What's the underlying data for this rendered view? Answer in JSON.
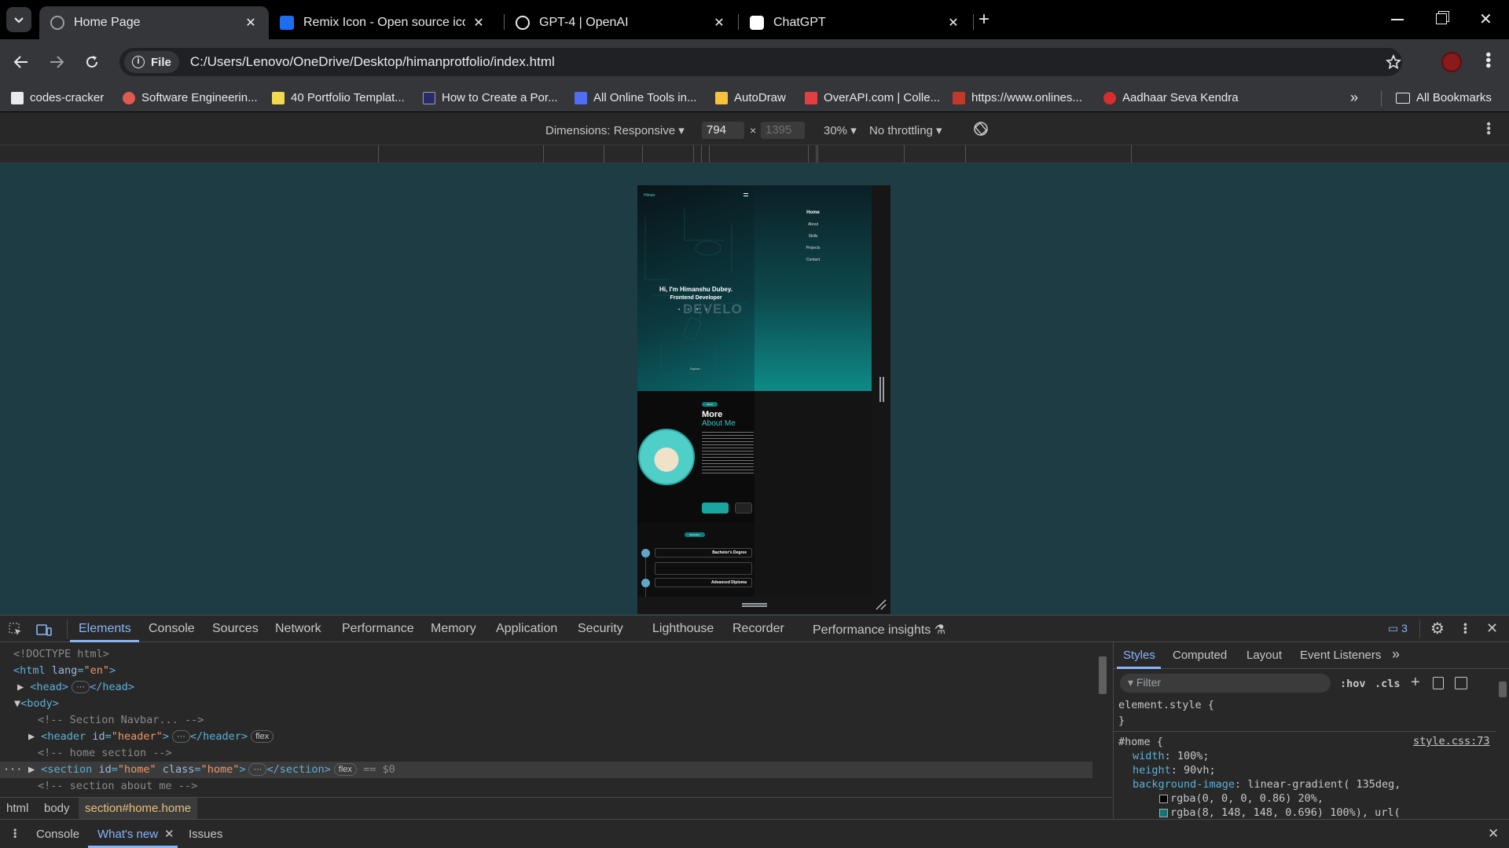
{
  "browser": {
    "tabs": [
      {
        "title": "Home Page",
        "active": true,
        "icon": "globe-icon"
      },
      {
        "title": "Remix Icon - Open source icon",
        "active": false,
        "icon": "remix-icon"
      },
      {
        "title": "GPT-4 | OpenAI",
        "active": false,
        "icon": "openai-icon"
      },
      {
        "title": "ChatGPT",
        "active": false,
        "icon": "chatgpt-icon"
      }
    ],
    "chip_label": "File",
    "url": "C:/Users/Lenovo/OneDrive/Desktop/himanprotfolio/index.html",
    "bookmarks": [
      {
        "label": "codes-cracker",
        "color": "#e8eaed"
      },
      {
        "label": "Software Engineerin...",
        "color": "#e05a4f"
      },
      {
        "label": "40 Portfolio Templat...",
        "color": "#f0db4f"
      },
      {
        "label": "How to Create a Por...",
        "color": "#2b2b6a"
      },
      {
        "label": "All Online Tools in...",
        "color": "#4f6df5"
      },
      {
        "label": "AutoDraw",
        "color": "#f7c23c"
      },
      {
        "label": "OverAPI.com | Colle...",
        "color": "#e04040"
      },
      {
        "label": "https://www.onlines...",
        "color": "#c0392b"
      },
      {
        "label": "Aadhaar Seva Kendra",
        "color": "#d62d2d"
      }
    ],
    "all_bookmarks_label": "All Bookmarks"
  },
  "device_toolbar": {
    "dimensions_label": "Dimensions: Responsive",
    "width": "794",
    "height": "1395",
    "zoom": "30%",
    "throttling": "No throttling"
  },
  "preview": {
    "logo": "Himan",
    "menu_items": [
      "Home",
      "About",
      "Skills",
      "Projects",
      "Contact"
    ],
    "hero_line1": "Hi, I'm Himanshu Dubey.",
    "hero_line2": "Frontend Developer",
    "hero_bg_word": "DEVELO",
    "explore": "Explore ↓",
    "about_badge": "About",
    "about_title1": "More",
    "about_title2": "About Me",
    "edu_badge": "Education",
    "edu_items": [
      "Bachelor's Degree",
      "Advanced Diploma"
    ]
  },
  "devtools": {
    "tabs": [
      "Elements",
      "Console",
      "Sources",
      "Network",
      "Performance",
      "Memory",
      "Application",
      "Security",
      "Lighthouse",
      "Recorder",
      "Performance insights"
    ],
    "issues_count": "3",
    "dom": {
      "doctype": "<!DOCTYPE html>",
      "html_open": "html",
      "html_attr": "lang",
      "html_val": "\"en\"",
      "head": "head",
      "body": "body",
      "comment_nav": "<!-- Section Navbar... -->",
      "header_tag": "header",
      "header_attr": "id",
      "header_val": "\"header\"",
      "comment_home": "<!-- home section  -->",
      "section_tag": "section",
      "section_id_attr": "id",
      "section_id_val": "\"home\"",
      "section_class_attr": "class",
      "section_class_val": "\"home\"",
      "flex_pill": "flex",
      "selected_marker": "== $0",
      "comment_about": "<!-- section about me -->"
    },
    "breadcrumbs": [
      "html",
      "body",
      "section#home.home"
    ],
    "styles_tabs": [
      "Styles",
      "Computed",
      "Layout",
      "Event Listeners"
    ],
    "filter_placeholder": "Filter",
    "hov": ":hov",
    "cls": ".cls",
    "element_style": "element.style {",
    "close_brace": "}",
    "rule_selector": "#home {",
    "rule_source": "style.css:73",
    "props": [
      {
        "name": "width",
        "value": "100%;"
      },
      {
        "name": "height",
        "value": "90vh;"
      },
      {
        "name": "background-image",
        "value": "linear-gradient( 135deg,"
      }
    ],
    "gradient_line1": "rgba(0, 0, 0, 0.86) 20%,",
    "gradient_line2": "rgba(8, 148, 148, 0.696) 100%), url(",
    "drawer_tabs": [
      "Console",
      "What's new",
      "Issues"
    ]
  }
}
